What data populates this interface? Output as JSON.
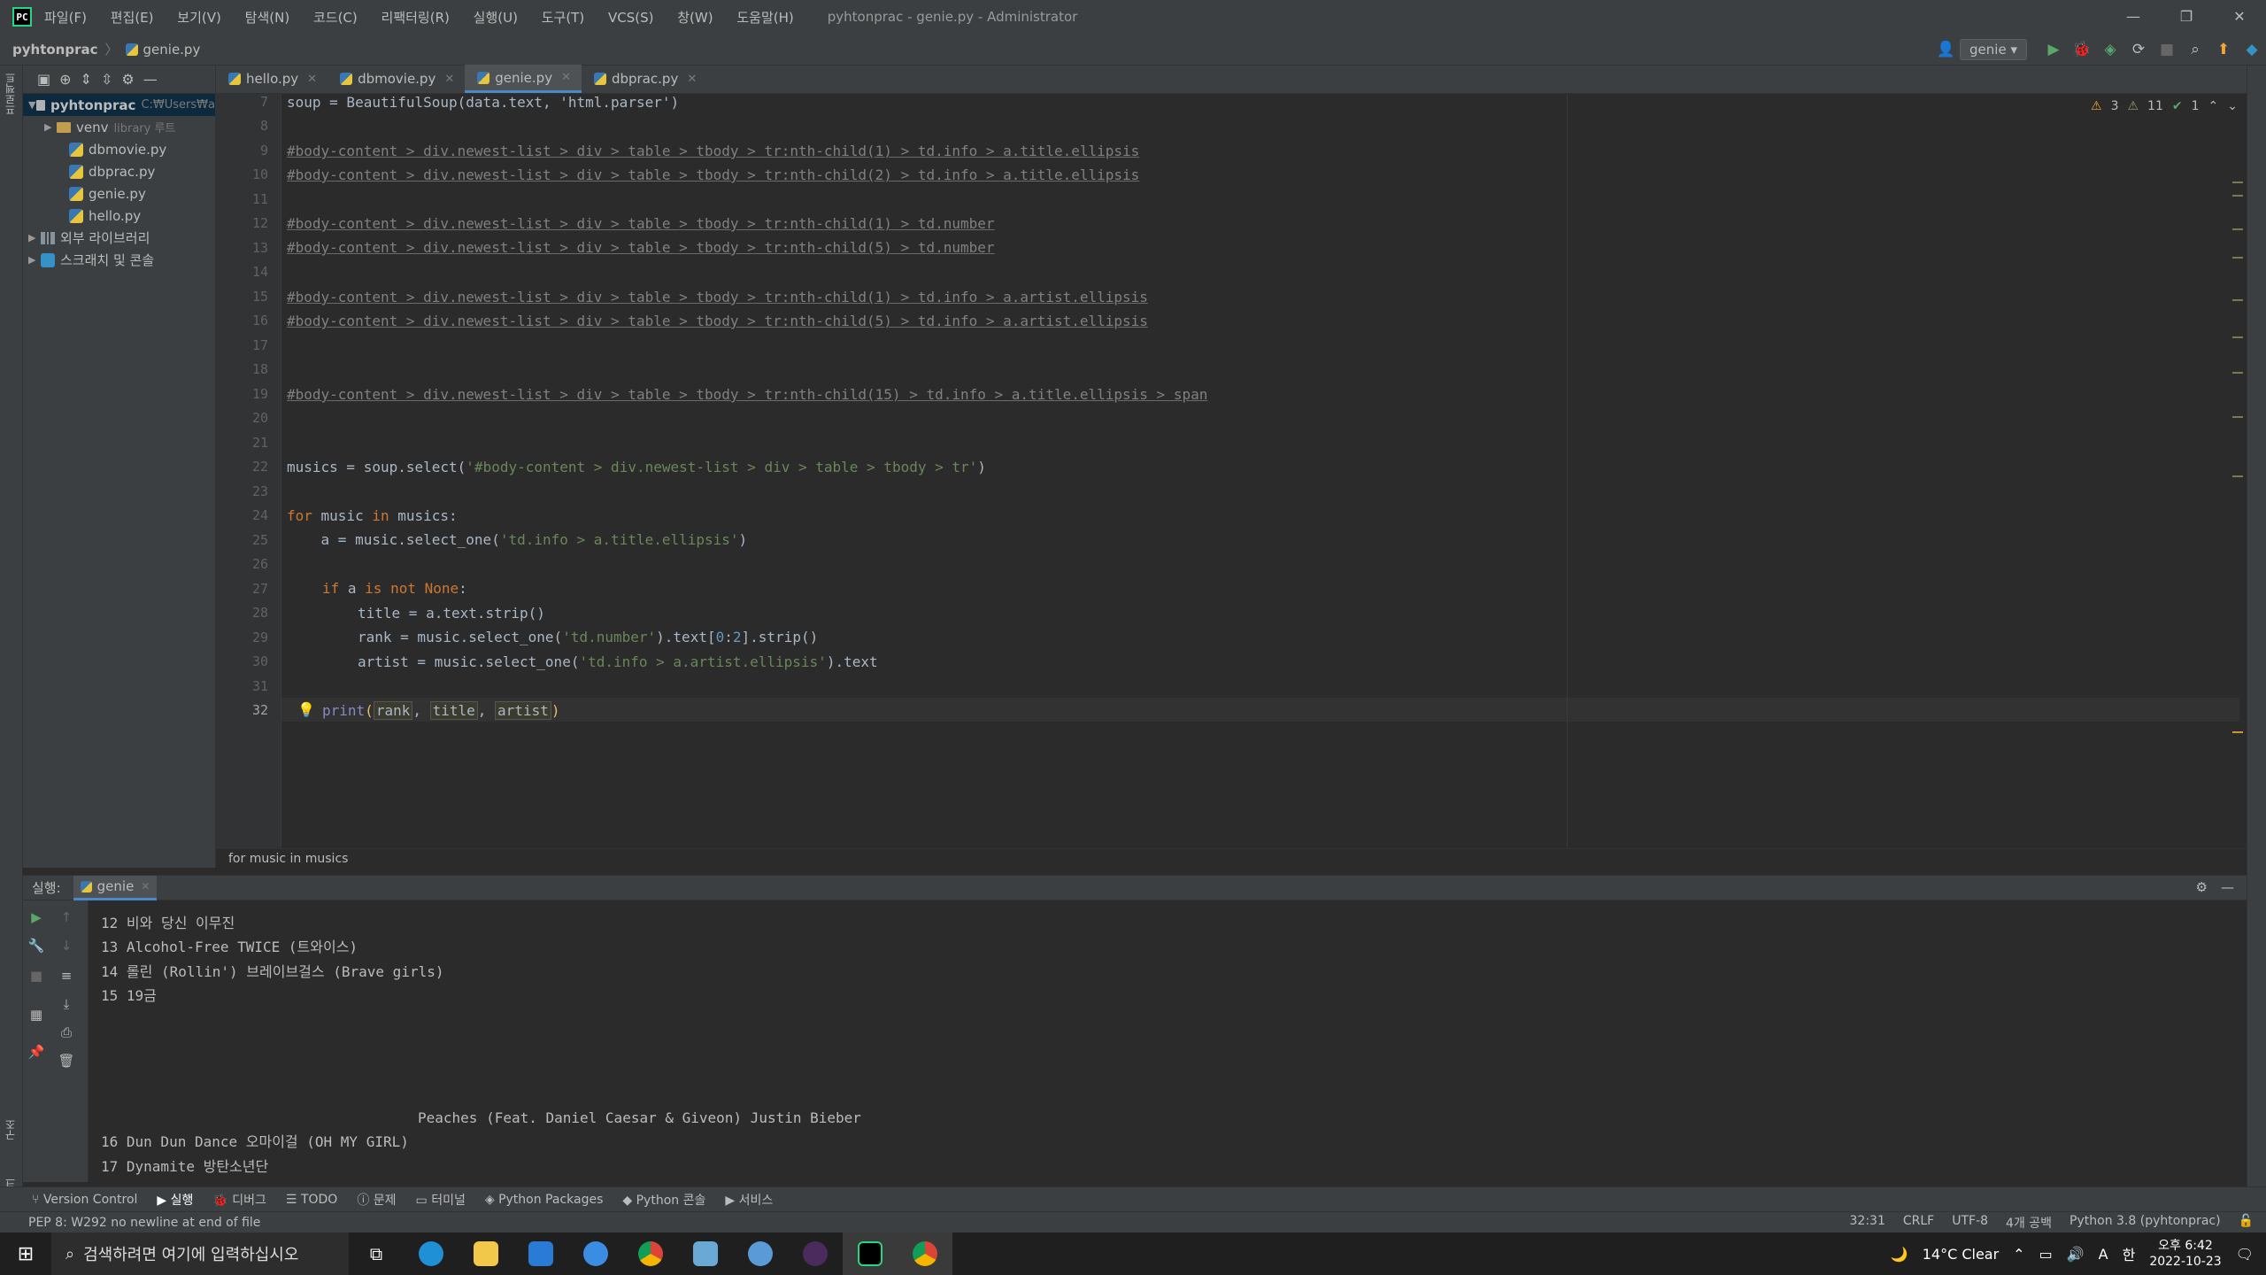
{
  "window": {
    "title": "pyhtonprac - genie.py - Administrator",
    "menu": [
      "파일(F)",
      "편집(E)",
      "보기(V)",
      "탐색(N)",
      "코드(C)",
      "리팩터링(R)",
      "실행(U)",
      "도구(T)",
      "VCS(S)",
      "창(W)",
      "도움말(H)"
    ]
  },
  "navbar": {
    "project": "pyhtonprac",
    "file": "genie.py",
    "run_config": "genie"
  },
  "project_tree": {
    "root": "pyhtonprac",
    "root_path": "C:₩Users₩a",
    "venv": "venv",
    "venv_hint": "library 루트",
    "files": [
      "dbmovie.py",
      "dbprac.py",
      "genie.py",
      "hello.py"
    ],
    "ext_libs": "외부 라이브러리",
    "scratch": "스크래치 및 콘솔"
  },
  "tabs": [
    "hello.py",
    "dbmovie.py",
    "genie.py",
    "dbprac.py"
  ],
  "inspections": {
    "warnings": "3",
    "weak": "11",
    "ok": "1"
  },
  "code_lines": {
    "l7": "soup = BeautifulSoup(data.text, 'html.parser')",
    "l9": "#body-content > div.newest-list > div > table > tbody > tr:nth-child(1) > td.info > a.title.ellipsis",
    "l10": "#body-content > div.newest-list > div > table > tbody > tr:nth-child(2) > td.info > a.title.ellipsis",
    "l12": "#body-content > div.newest-list > div > table > tbody > tr:nth-child(1) > td.number",
    "l13": "#body-content > div.newest-list > div > table > tbody > tr:nth-child(5) > td.number",
    "l15": "#body-content > div.newest-list > div > table > tbody > tr:nth-child(1) > td.info > a.artist.ellipsis",
    "l16": "#body-content > div.newest-list > div > table > tbody > tr:nth-child(5) > td.info > a.artist.ellipsis",
    "l19": "#body-content > div.newest-list > div > table > tbody > tr:nth-child(15) > td.info > a.title.ellipsis > span",
    "l22a": "musics = soup.select(",
    "l22b": "'#body-content > div.newest-list > div > table > tbody > tr'",
    "l22c": ")",
    "l24a": "for",
    "l24b": " music ",
    "l24c": "in",
    "l24d": " musics:",
    "l25a": "    a = music.select_one(",
    "l25b": "'td.info > a.title.ellipsis'",
    "l25c": ")",
    "l27a": "if",
    "l27b": " a ",
    "l27c": "is not None",
    "l27d": ":",
    "l28": "title = a.text.strip()",
    "l29a": "rank = music.select_one(",
    "l29b": "'td.number'",
    "l29c": ").text[",
    "l29d": "0",
    "l29e": ":",
    "l29f": "2",
    "l29g": "].strip()",
    "l30a": "artist = music.select_one(",
    "l30b": "'td.info > a.artist.ellipsis'",
    "l30c": ").text",
    "l32a": "print",
    "l32b": "(",
    "l32c": "rank",
    "l32d": ", ",
    "l32e": "title",
    "l32f": ", ",
    "l32g": "artist",
    "l32h": ")"
  },
  "line_numbers": [
    "7",
    "8",
    "9",
    "10",
    "11",
    "12",
    "13",
    "14",
    "15",
    "16",
    "17",
    "18",
    "19",
    "20",
    "21",
    "22",
    "23",
    "24",
    "25",
    "26",
    "27",
    "28",
    "29",
    "30",
    "31",
    "32"
  ],
  "editor_breadcrumb": "for music in musics",
  "run_panel": {
    "label": "실행:",
    "tab": "genie",
    "output": [
      "12 비와 당신 이무진",
      "13 Alcohol-Free TWICE (트와이스)",
      "14 롤린 (Rollin') 브레이브걸스 (Brave girls)",
      "15 19금",
      "Peaches (Feat. Daniel Caesar & Giveon) Justin Bieber",
      "16 Dun Dun Dance 오마이걸 (OH MY GIRL)",
      "17 Dynamite 방탄소년단"
    ]
  },
  "bottom_tabs": [
    "Version Control",
    "실행",
    "디버그",
    "TODO",
    "문제",
    "터미널",
    "Python Packages",
    "Python 콘솔",
    "서비스"
  ],
  "status": {
    "message": "PEP 8: W292 no newline at end of file",
    "position": "32:31",
    "line_sep": "CRLF",
    "encoding": "UTF-8",
    "indent": "4개 공백",
    "interpreter": "Python 3.8 (pyhtonprac)"
  },
  "taskbar": {
    "search_placeholder": "검색하려면 여기에 입력하십시오",
    "weather": "14°C  Clear",
    "time": "오후 6:42",
    "date": "2022-10-23",
    "ime": "A",
    "ime2": "한"
  },
  "left_strip": {
    "project_label": "프로젝트",
    "structure_label": "구조",
    "bookmarks_label": "북마크"
  }
}
